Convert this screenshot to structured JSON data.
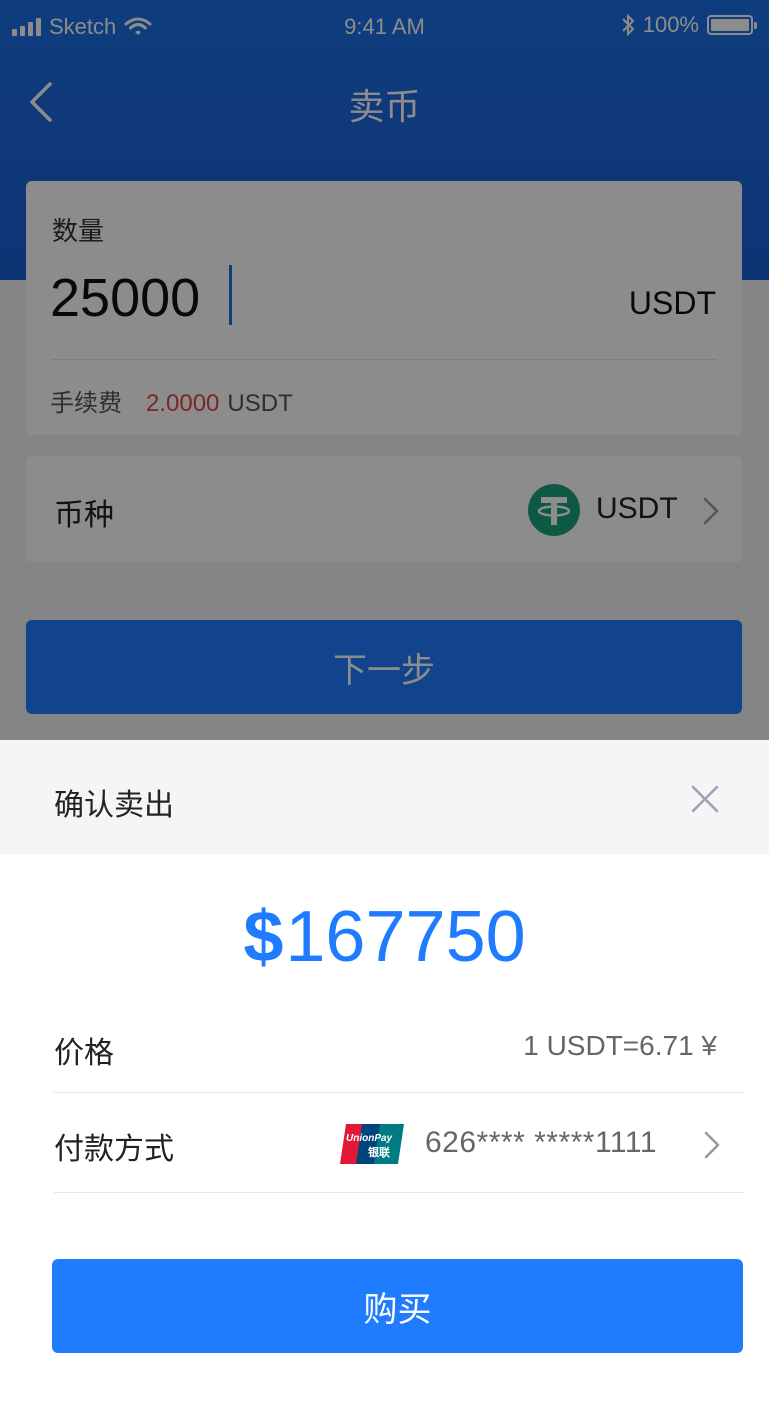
{
  "status_bar": {
    "carrier": "Sketch",
    "time": "9:41 AM",
    "battery": "100%"
  },
  "nav": {
    "title": "卖币"
  },
  "quantity": {
    "label": "数量",
    "value": "25000",
    "unit": "USDT"
  },
  "fee": {
    "label": "手续费",
    "amount": "2.0000",
    "unit": "USDT"
  },
  "currency": {
    "label": "币种",
    "coin": "USDT",
    "icon": "tether-icon"
  },
  "next_button": {
    "label": "下一步"
  },
  "sheet": {
    "title": "确认卖出",
    "amount_symbol": "$",
    "amount": "167750",
    "price": {
      "label": "价格",
      "value": "1 USDT=6.71 ¥"
    },
    "payment": {
      "label": "付款方式",
      "method_icon": "unionpay-icon",
      "card_number": "626**** *****1111"
    },
    "buy_button": {
      "label": "购买"
    }
  },
  "colors": {
    "primary": "#1f7cff",
    "fee_red": "#e04848",
    "tether_green": "#1aa37a"
  }
}
